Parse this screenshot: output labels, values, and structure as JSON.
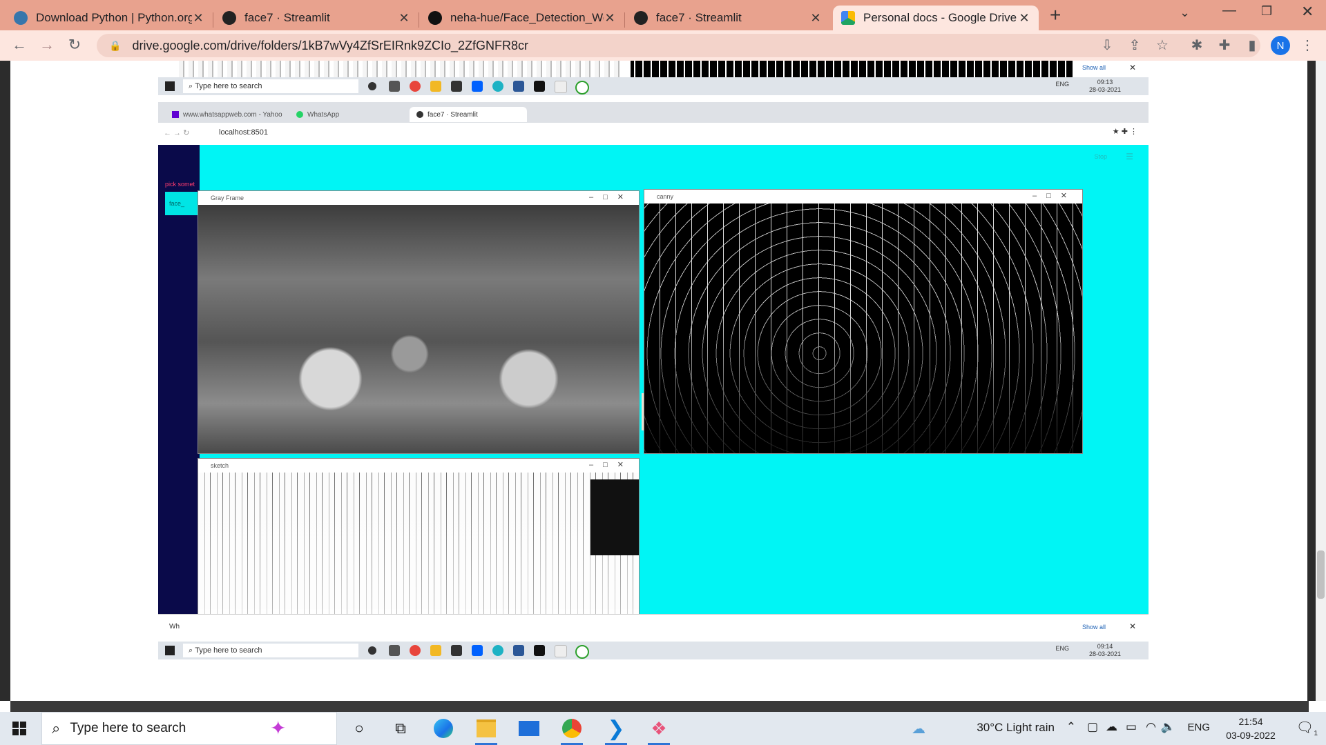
{
  "browser": {
    "tabs": [
      {
        "title": "Download Python | Python.org",
        "icon": "python-icon",
        "color": "#3776ab"
      },
      {
        "title": "face7 · Streamlit",
        "icon": "streamlit-icon",
        "color": "#222222"
      },
      {
        "title": "neha-hue/Face_Detection_WebAp",
        "icon": "github-icon",
        "color": "#111111"
      },
      {
        "title": "face7 · Streamlit",
        "icon": "streamlit-icon",
        "color": "#222222"
      },
      {
        "title": "Personal docs - Google Drive",
        "icon": "google-drive-icon",
        "color": "#1fa463"
      }
    ],
    "active_tab": 4,
    "url": "drive.google.com/drive/folders/1kB7wVy4ZfSrEIRnk9ZCIo_2ZfGNFR8cr",
    "profile_initial": "N",
    "accent": "#1a73e8"
  },
  "embedded": {
    "top_taskbar": {
      "search": "Type here to search",
      "lang": "ENG",
      "time": "09:13",
      "date": "28-03-2021",
      "show_all": "Show all"
    },
    "inner_tabs": [
      "www.whatsappweb.com - Yahoo",
      "WhatsApp",
      "face7 · Streamlit"
    ],
    "inner_url": "localhost:8501",
    "sidebar_text": "pick somet",
    "sidebar_button": "face_",
    "stop": "Stop",
    "windows": [
      {
        "title": "Gray Frame"
      },
      {
        "title": "canny"
      },
      {
        "title": "sketch"
      }
    ],
    "download_item": "Wh",
    "bottom_taskbar": {
      "search": "Type here to search",
      "lang": "ENG",
      "time": "09:14",
      "date": "28-03-2021",
      "show_all": "Show all"
    },
    "streamlit_bg": "#00f5f5",
    "sidebar_bg": "#0a0a4a"
  },
  "taskbar": {
    "search_placeholder": "Type here to search",
    "weather": "30°C  Light rain",
    "lang": "ENG",
    "time": "21:54",
    "date": "03-09-2022",
    "notifications": "1"
  }
}
